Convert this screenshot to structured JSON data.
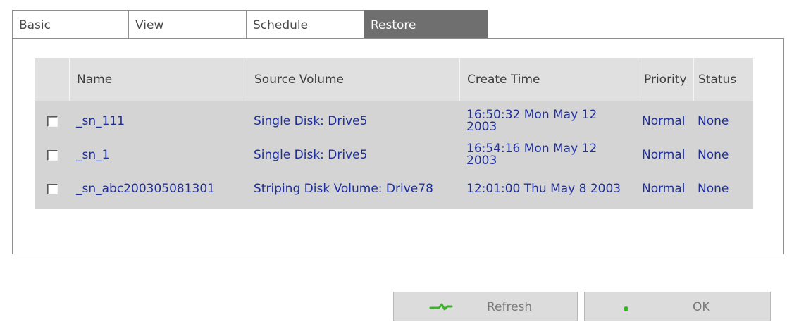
{
  "tabs": [
    {
      "label": "Basic",
      "active": false
    },
    {
      "label": "View",
      "active": false
    },
    {
      "label": "Schedule",
      "active": false
    },
    {
      "label": "Restore",
      "active": true
    }
  ],
  "table": {
    "columns": [
      "",
      "Name",
      "Source Volume",
      "Create Time",
      "Priority",
      "Status"
    ],
    "rows": [
      {
        "checked": false,
        "name": "_sn_111",
        "source": "Single Disk: Drive5",
        "time": "16:50:32 Mon May 12 2003",
        "priority": "Normal",
        "status": "None"
      },
      {
        "checked": false,
        "name": "_sn_1",
        "source": "Single Disk: Drive5",
        "time": "16:54:16 Mon May 12 2003",
        "priority": "Normal",
        "status": "None"
      },
      {
        "checked": false,
        "name": "_sn_abc200305081301",
        "source": "Striping Disk Volume: Drive78",
        "time": "12:01:00 Thu May 8 2003",
        "priority": "Normal",
        "status": "None"
      }
    ]
  },
  "buttons": {
    "refresh": {
      "label": "Refresh",
      "icon": "refresh-arrows-icon"
    },
    "ok": {
      "label": "OK",
      "icon": "ok-dot-icon"
    }
  },
  "colors": {
    "link_text": "#1f2f9a",
    "active_tab": "#6f6f6f",
    "icon_green": "#3db32b"
  }
}
